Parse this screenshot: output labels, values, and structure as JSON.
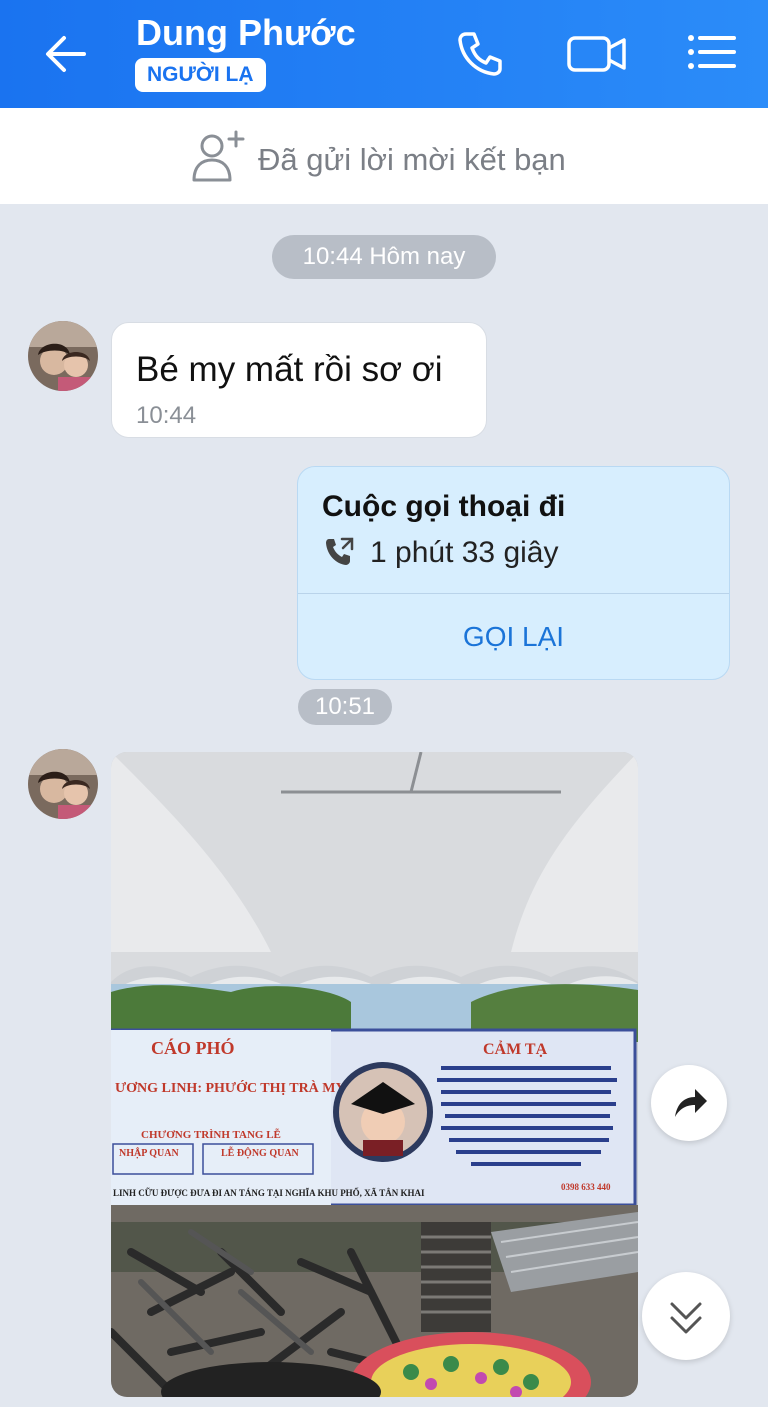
{
  "header": {
    "contact_name": "Dung Phước",
    "badge": "NGƯỜI LẠ"
  },
  "friend_request": {
    "text": "Đã gửi lời mời kết bạn"
  },
  "messages": {
    "timestamp_1": "10:44 Hôm nay",
    "msg_1_text": "Bé my mất rồi sơ ơi",
    "msg_1_time": "10:44",
    "call_title": "Cuộc gọi thoại đi",
    "call_duration": "1 phút 33 giây",
    "call_action": "GỌI LẠI",
    "timestamp_2": "10:51"
  },
  "photo": {
    "banner_left_title": "CÁO PHÓ",
    "banner_name": "ƯƠNG LINH: PHƯỚC THỊ TRÀ MY",
    "banner_right_title": "CẢM TẠ",
    "banner_program": "CHƯƠNG TRÌNH TANG LỄ",
    "banner_box_1": "NHẬP QUAN",
    "banner_box_2": "LỄ ĐỘNG QUAN",
    "banner_footer": "LINH CỮU ĐƯỢC ĐƯA ĐI AN TÁNG TẠI NGHĨA KHU PHỐ, XÃ TÂN KHAI",
    "banner_phone": "0398 633 440"
  },
  "colors": {
    "header": "#1a73f0",
    "background": "#e2e7ef",
    "call_card": "#d7eefe",
    "callback": "#1b74d8"
  }
}
